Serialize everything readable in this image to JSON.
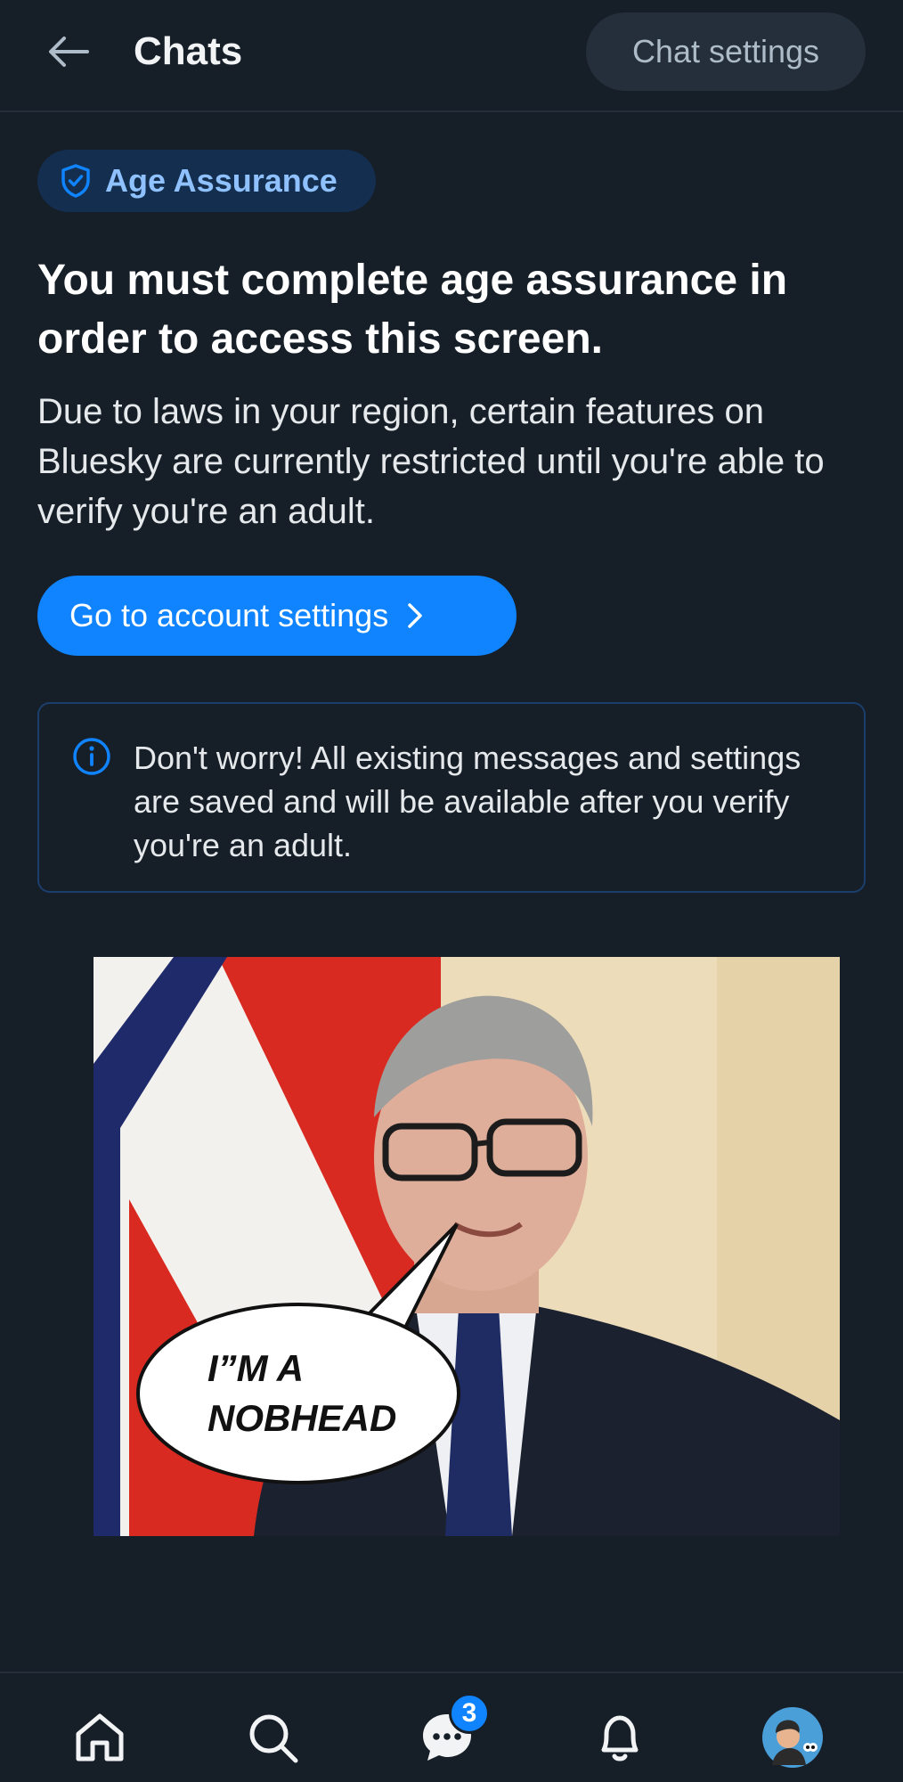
{
  "header": {
    "title": "Chats",
    "settings_label": "Chat settings"
  },
  "badge": {
    "label": "Age Assurance",
    "icon": "shield-check-icon"
  },
  "main": {
    "heading": "You must complete age assurance in order to access this screen.",
    "description": "Due to laws in your region, certain features on Bluesky are currently restricted until you're able to verify you're an adult.",
    "primary_button": "Go to account settings",
    "info": "Don't worry! All existing messages and settings are saved and will be available after you verify you're an adult."
  },
  "image": {
    "speech_text": "I”M A NOBHEAD"
  },
  "nav": {
    "items": [
      "home-icon",
      "search-icon",
      "chat-icon",
      "bell-icon",
      "avatar"
    ],
    "chat_badge": "3"
  },
  "colors": {
    "background": "#161e27",
    "accent": "#1083fe",
    "badge_bg": "#132e4e",
    "badge_text": "#8fc1ff"
  }
}
